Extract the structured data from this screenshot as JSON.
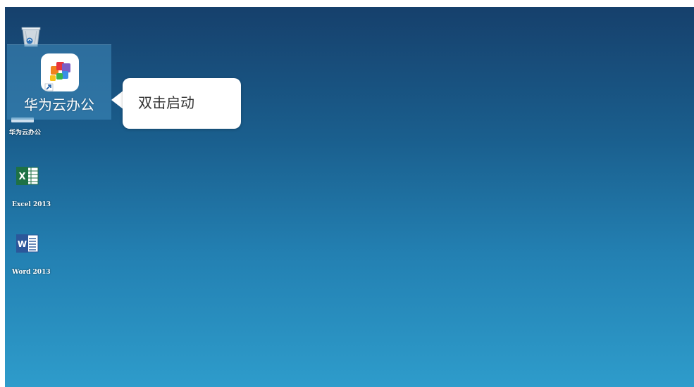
{
  "desktop": {
    "icons": {
      "recycle_bin": {
        "icon": "recycle-bin-icon"
      },
      "huawei_cloud_office": {
        "label": "华为云办公",
        "zoom_label": "华为云办公",
        "icon": "huawei-cloud-office-icon"
      },
      "excel": {
        "label": "Excel 2013",
        "icon": "excel-icon",
        "color": "#1e7145"
      },
      "word": {
        "label": "Word 2013",
        "icon": "word-icon",
        "color": "#2b579a"
      }
    },
    "callout": {
      "text": "双击启动"
    }
  },
  "colors": {
    "desktop_top": "#16406c",
    "desktop_bottom": "#2e9ccb",
    "callout_bg": "#ffffff"
  }
}
